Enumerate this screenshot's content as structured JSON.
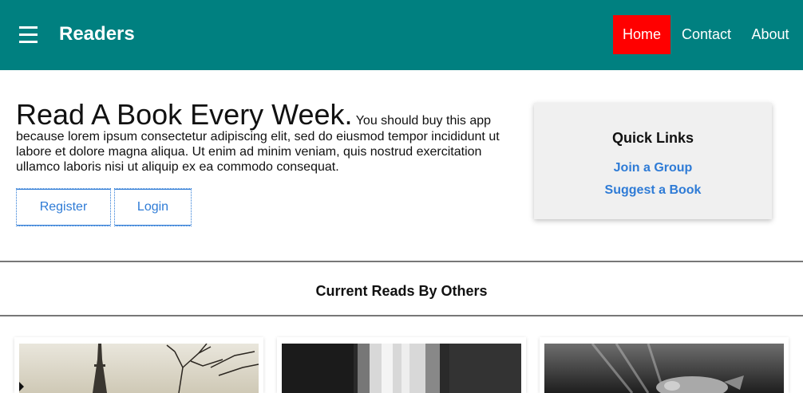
{
  "header": {
    "brand": "Readers",
    "nav": [
      {
        "label": "Home",
        "active": true
      },
      {
        "label": "Contact",
        "active": false
      },
      {
        "label": "About",
        "active": false
      }
    ],
    "accent": "#008080",
    "active_color": "#ff0000"
  },
  "hero": {
    "title": "Read A Book Every Week.",
    "body": "You should buy this app because lorem ipsum consectetur adipiscing elit, sed do eiusmod tempor incididunt ut labore et dolore magna aliqua. Ut enim ad minim veniam, quis nostrud exercitation ullamco laboris nisi ut aliquip ex ea commodo consequat.",
    "register_label": "Register",
    "login_label": "Login"
  },
  "quick_links": {
    "title": "Quick Links",
    "links": [
      "Join a Group",
      "Suggest a Book"
    ]
  },
  "current_reads": {
    "title": "Current Reads By Others",
    "images": [
      "eiffel-tower-photo",
      "waterfall-photo",
      "underwater-photo"
    ]
  }
}
